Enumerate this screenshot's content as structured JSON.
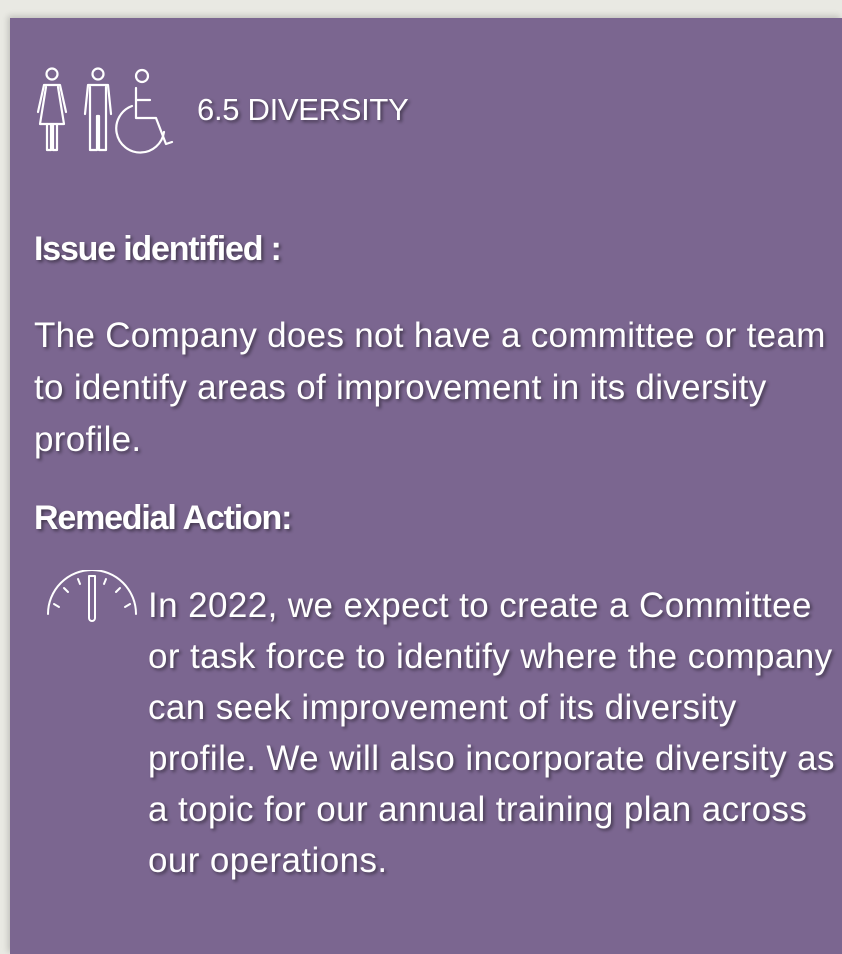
{
  "section": {
    "icon": "people-diversity-icon",
    "title": "6.5 DIVERSITY"
  },
  "issue": {
    "heading": "Issue identified :",
    "text": "The Company does not have a committee or team to identify areas of improvement in its diversity profile."
  },
  "action": {
    "heading": "Remedial Action:",
    "icon": "gauge-icon",
    "text": "In 2022, we expect to create a Committee or task force to identify where the company can seek improvement of its diversity profile. We will also incorporate diversity as a topic for our annual training plan across our operations."
  },
  "colors": {
    "card_background": "#7b6690",
    "text": "#ffffff",
    "page_background": "#e9e9e3"
  }
}
